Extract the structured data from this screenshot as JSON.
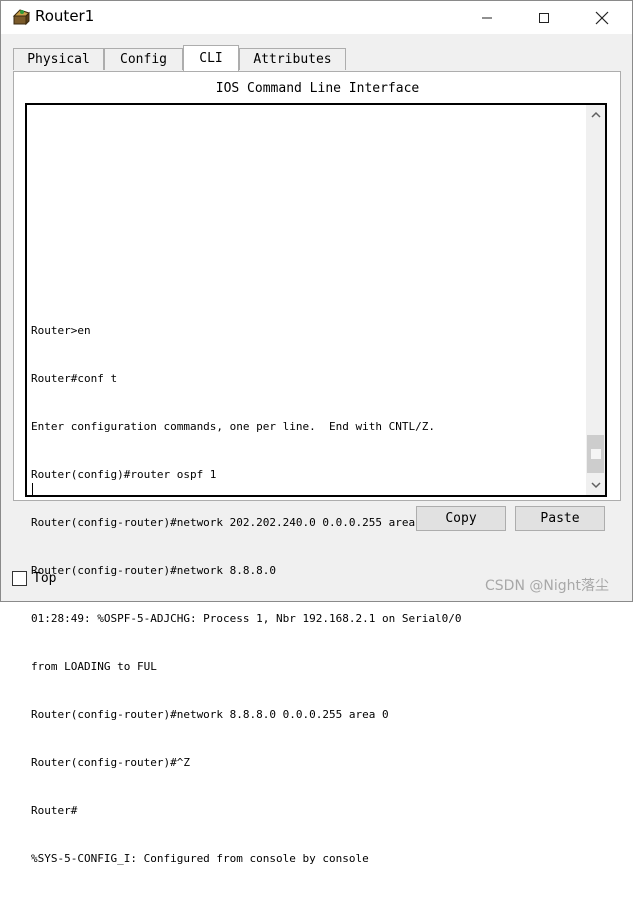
{
  "window": {
    "title": "Router1",
    "icon": "router-icon"
  },
  "tabs": [
    {
      "label": "Physical",
      "active": false
    },
    {
      "label": "Config",
      "active": false
    },
    {
      "label": "CLI",
      "active": true
    },
    {
      "label": "Attributes",
      "active": false
    }
  ],
  "cli": {
    "heading": "IOS Command Line Interface",
    "lines": [
      "Router>en",
      "Router#conf t",
      "Enter configuration commands, one per line.  End with CNTL/Z.",
      "Router(config)#router ospf 1",
      "Router(config-router)#network 202.202.240.0 0.0.0.255 area 0",
      "Router(config-router)#network 8.8.8.0",
      "01:28:49: %OSPF-5-ADJCHG: Process 1, Nbr 192.168.2.1 on Serial0/0",
      "from LOADING to FUL",
      "Router(config-router)#network 8.8.8.0 0.0.0.255 area 0",
      "Router(config-router)#^Z",
      "Router#",
      "%SYS-5-CONFIG_I: Configured from console by console"
    ]
  },
  "buttons": {
    "copy": "Copy",
    "paste": "Paste"
  },
  "footer": {
    "top_label": "Top",
    "top_checked": false,
    "watermark": "CSDN @Night落尘"
  }
}
